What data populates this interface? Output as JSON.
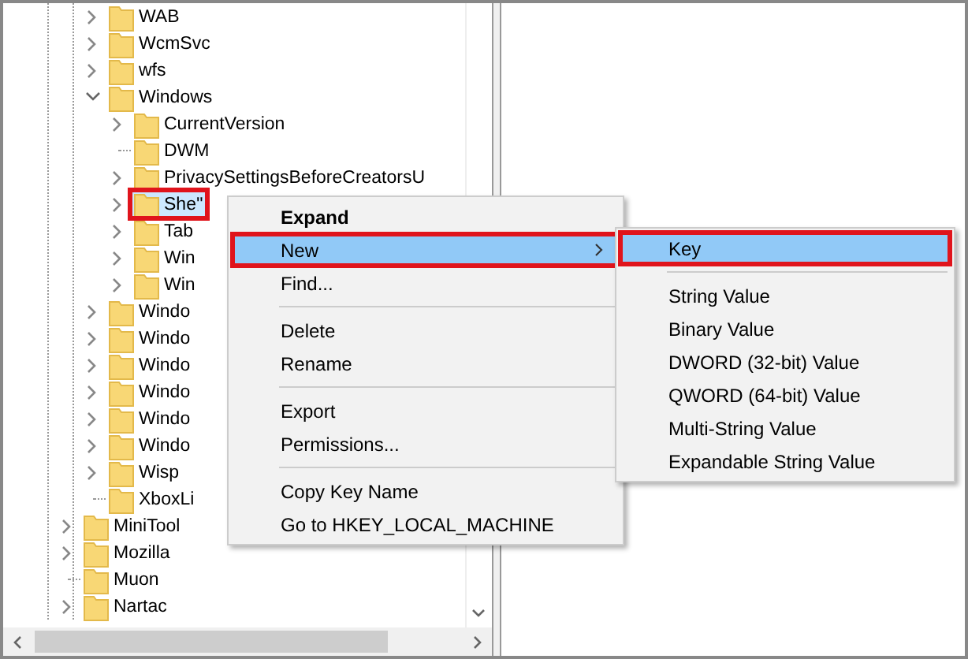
{
  "tree": [
    {
      "label": "WAB",
      "kind": "collapsed",
      "selected": false,
      "highlighted": false
    },
    {
      "label": "WcmSvc",
      "kind": "collapsed",
      "selected": false,
      "highlighted": false
    },
    {
      "label": "wfs",
      "kind": "collapsed",
      "selected": false,
      "highlighted": false
    },
    {
      "label": "Windows",
      "kind": "expanded",
      "selected": false,
      "highlighted": false,
      "children": [
        {
          "label": "CurrentVersion",
          "kind": "collapsed",
          "selected": false,
          "highlighted": false
        },
        {
          "label": "DWM",
          "kind": "leaf",
          "selected": false,
          "highlighted": false
        },
        {
          "label": "PrivacySettingsBeforeCreatorsU",
          "kind": "collapsed",
          "selected": false,
          "highlighted": false
        },
        {
          "label": "She''",
          "kind": "collapsed",
          "selected": true,
          "highlighted": true
        },
        {
          "label": "Tab",
          "kind": "collapsed",
          "selected": false,
          "highlighted": false
        },
        {
          "label": "Win",
          "kind": "collapsed",
          "selected": false,
          "highlighted": false
        },
        {
          "label": "Win",
          "kind": "collapsed",
          "selected": false,
          "highlighted": false
        }
      ]
    },
    {
      "label": "Windo",
      "kind": "collapsed",
      "selected": false,
      "highlighted": false
    },
    {
      "label": "Windo",
      "kind": "collapsed",
      "selected": false,
      "highlighted": false
    },
    {
      "label": "Windo",
      "kind": "collapsed",
      "selected": false,
      "highlighted": false
    },
    {
      "label": "Windo",
      "kind": "collapsed",
      "selected": false,
      "highlighted": false
    },
    {
      "label": "Windo",
      "kind": "collapsed",
      "selected": false,
      "highlighted": false
    },
    {
      "label": "Windo",
      "kind": "collapsed",
      "selected": false,
      "highlighted": false
    },
    {
      "label": "Wisp",
      "kind": "collapsed",
      "selected": false,
      "highlighted": false
    },
    {
      "label": "XboxLi",
      "kind": "leaf",
      "selected": false,
      "highlighted": false
    }
  ],
  "tree_parent_siblings": [
    {
      "label": "MiniTool",
      "kind": "collapsed",
      "selected": false,
      "highlighted": false
    },
    {
      "label": "Mozilla",
      "kind": "collapsed",
      "selected": false,
      "highlighted": false
    },
    {
      "label": "Muon",
      "kind": "leaf",
      "selected": false,
      "highlighted": false
    },
    {
      "label": "Nartac",
      "kind": "collapsed",
      "selected": false,
      "highlighted": false
    }
  ],
  "context_menu": [
    {
      "kind": "item",
      "label": "Expand",
      "bold": true,
      "submenu": false,
      "selected": false,
      "highlighted": false
    },
    {
      "kind": "item",
      "label": "New",
      "bold": false,
      "submenu": true,
      "selected": true,
      "highlighted": true
    },
    {
      "kind": "item",
      "label": "Find...",
      "bold": false,
      "submenu": false,
      "selected": false,
      "highlighted": false
    },
    {
      "kind": "separator"
    },
    {
      "kind": "item",
      "label": "Delete",
      "bold": false,
      "submenu": false,
      "selected": false,
      "highlighted": false
    },
    {
      "kind": "item",
      "label": "Rename",
      "bold": false,
      "submenu": false,
      "selected": false,
      "highlighted": false
    },
    {
      "kind": "separator"
    },
    {
      "kind": "item",
      "label": "Export",
      "bold": false,
      "submenu": false,
      "selected": false,
      "highlighted": false
    },
    {
      "kind": "item",
      "label": "Permissions...",
      "bold": false,
      "submenu": false,
      "selected": false,
      "highlighted": false
    },
    {
      "kind": "separator"
    },
    {
      "kind": "item",
      "label": "Copy Key Name",
      "bold": false,
      "submenu": false,
      "selected": false,
      "highlighted": false
    },
    {
      "kind": "item",
      "label": "Go to HKEY_LOCAL_MACHINE",
      "bold": false,
      "submenu": false,
      "selected": false,
      "highlighted": false
    }
  ],
  "submenu": [
    {
      "kind": "item",
      "label": "Key",
      "selected": true,
      "highlighted": true
    },
    {
      "kind": "separator"
    },
    {
      "kind": "item",
      "label": "String Value",
      "selected": false,
      "highlighted": false
    },
    {
      "kind": "item",
      "label": "Binary Value",
      "selected": false,
      "highlighted": false
    },
    {
      "kind": "item",
      "label": "DWORD (32-bit) Value",
      "selected": false,
      "highlighted": false
    },
    {
      "kind": "item",
      "label": "QWORD (64-bit) Value",
      "selected": false,
      "highlighted": false
    },
    {
      "kind": "item",
      "label": "Multi-String Value",
      "selected": false,
      "highlighted": false
    },
    {
      "kind": "item",
      "label": "Expandable String Value",
      "selected": false,
      "highlighted": false
    }
  ]
}
